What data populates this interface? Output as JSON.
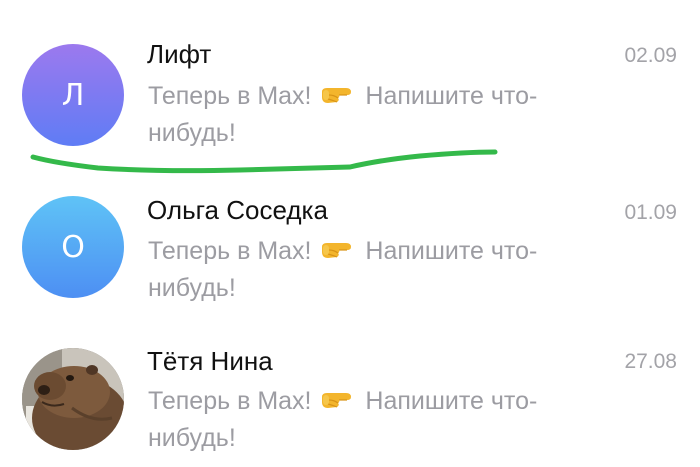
{
  "chats": [
    {
      "avatar_letter": "Л",
      "name": "Лифт",
      "date": "02.09",
      "preview_before": "Теперь в Max!",
      "preview_icon": "backhand-index-pointing-right-icon",
      "preview_after": "Напишите что-нибудь!"
    },
    {
      "avatar_letter": "О",
      "name": "Ольга Соседка",
      "date": "01.09",
      "preview_before": "Теперь в Max!",
      "preview_icon": "backhand-index-pointing-right-icon",
      "preview_after": "Напишите что-нибудь!"
    },
    {
      "avatar_image": "capybara-photo",
      "name": "Тётя Нина",
      "date": "27.08",
      "preview_before": "Теперь в Max!",
      "preview_icon": "backhand-index-pointing-right-icon",
      "preview_after": "Напишите что-нибудь!"
    }
  ],
  "colors": {
    "name_text": "#111111",
    "secondary_text": "#9c9ca2",
    "date_text": "#a3a3a8",
    "avatar_purple": "#8a78f0",
    "avatar_blue": "#52a8f5",
    "annotation_green": "#34b94a"
  }
}
